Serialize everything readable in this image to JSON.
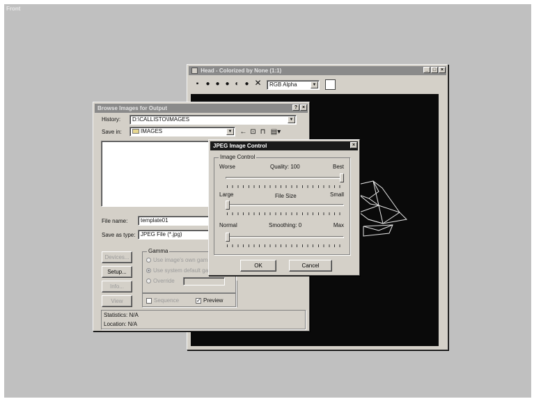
{
  "viewport": {
    "label": "Front"
  },
  "frame_window": {
    "title": "Head - Colorized by None (1:1)",
    "channel_select": "RGB Alpha",
    "caption_buttons": [
      "_",
      "□",
      "×"
    ]
  },
  "browse_dialog": {
    "title": "Browse Images for Output",
    "help": "?",
    "close": "×",
    "history_label": "History:",
    "history_value": "D:\\CALLISTO\\IMAGES",
    "save_in_label": "Save in:",
    "save_in_value": "IMAGES",
    "filename_label": "File name:",
    "filename_value": "template01",
    "save_as_label": "Save as type:",
    "save_as_value": "JPEG File (*.jpg)",
    "buttons": {
      "devices": "Devices...",
      "setup": "Setup...",
      "info": "Info...",
      "view": "View"
    },
    "gamma": {
      "title": "Gamma",
      "opt_own": "Use image's own gamma",
      "opt_system": "Use system default gamma",
      "opt_override": "Override"
    },
    "sequence": "Sequence",
    "preview": "Preview",
    "statistics": "Statistics: N/A",
    "location": "Location: N/A"
  },
  "jpeg_dialog": {
    "title": "JPEG Image Control",
    "close": "×",
    "group_title": "Image Control",
    "quality": {
      "left": "Worse",
      "center_label": "Quality:",
      "value": "100",
      "right": "Best",
      "level": 1.0
    },
    "filesize": {
      "left": "Large",
      "center_label": "File Size",
      "right": "Small",
      "level": 0.0
    },
    "smoothing": {
      "left": "Normal",
      "center_label": "Smoothing:",
      "value": "0",
      "right": "Max",
      "level": 0.0
    },
    "ok": "OK",
    "cancel": "Cancel"
  }
}
